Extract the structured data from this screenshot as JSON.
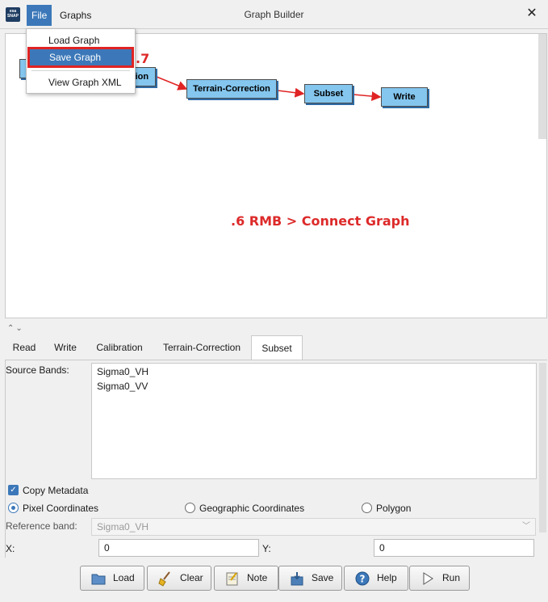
{
  "window": {
    "title": "Graph Builder",
    "app_icon_text": "esa SNAP"
  },
  "menubar": {
    "file": "File",
    "graphs": "Graphs"
  },
  "file_menu": {
    "items": [
      "Load Graph",
      "Save Graph",
      "View Graph XML"
    ],
    "highlighted": "Save Graph"
  },
  "graph": {
    "nodes": {
      "read": "",
      "calibration": "tion",
      "terrain": "Terrain-Correction",
      "subset": "Subset",
      "write": "Write"
    }
  },
  "annotations": {
    "step6": ".6 RMB > Connect Graph",
    "step7": ".7"
  },
  "tabs": [
    "Read",
    "Write",
    "Calibration",
    "Terrain-Correction",
    "Subset"
  ],
  "active_tab": "Subset",
  "subset_panel": {
    "source_bands_label": "Source Bands:",
    "bands": [
      "Sigma0_VH",
      "Sigma0_VV"
    ],
    "copy_metadata_label": "Copy Metadata",
    "copy_metadata_checked": true,
    "pixel_coordinates_label": "Pixel Coordinates",
    "geographic_coordinates_label": "Geographic Coordinates",
    "polygon_label": "Polygon",
    "selected_coordinates": "Pixel Coordinates",
    "reference_band_label": "Reference band:",
    "reference_band_value": "Sigma0_VH",
    "x_label": "X:",
    "x_value": "0",
    "y_label": "Y:",
    "y_value": "0"
  },
  "buttons": {
    "load": "Load",
    "clear": "Clear",
    "note": "Note",
    "save": "Save",
    "help": "Help",
    "run": "Run"
  },
  "colors": {
    "accent": "#3c78b9",
    "node_fill": "#84c6ee",
    "annotation_red": "#dd2a2a"
  }
}
